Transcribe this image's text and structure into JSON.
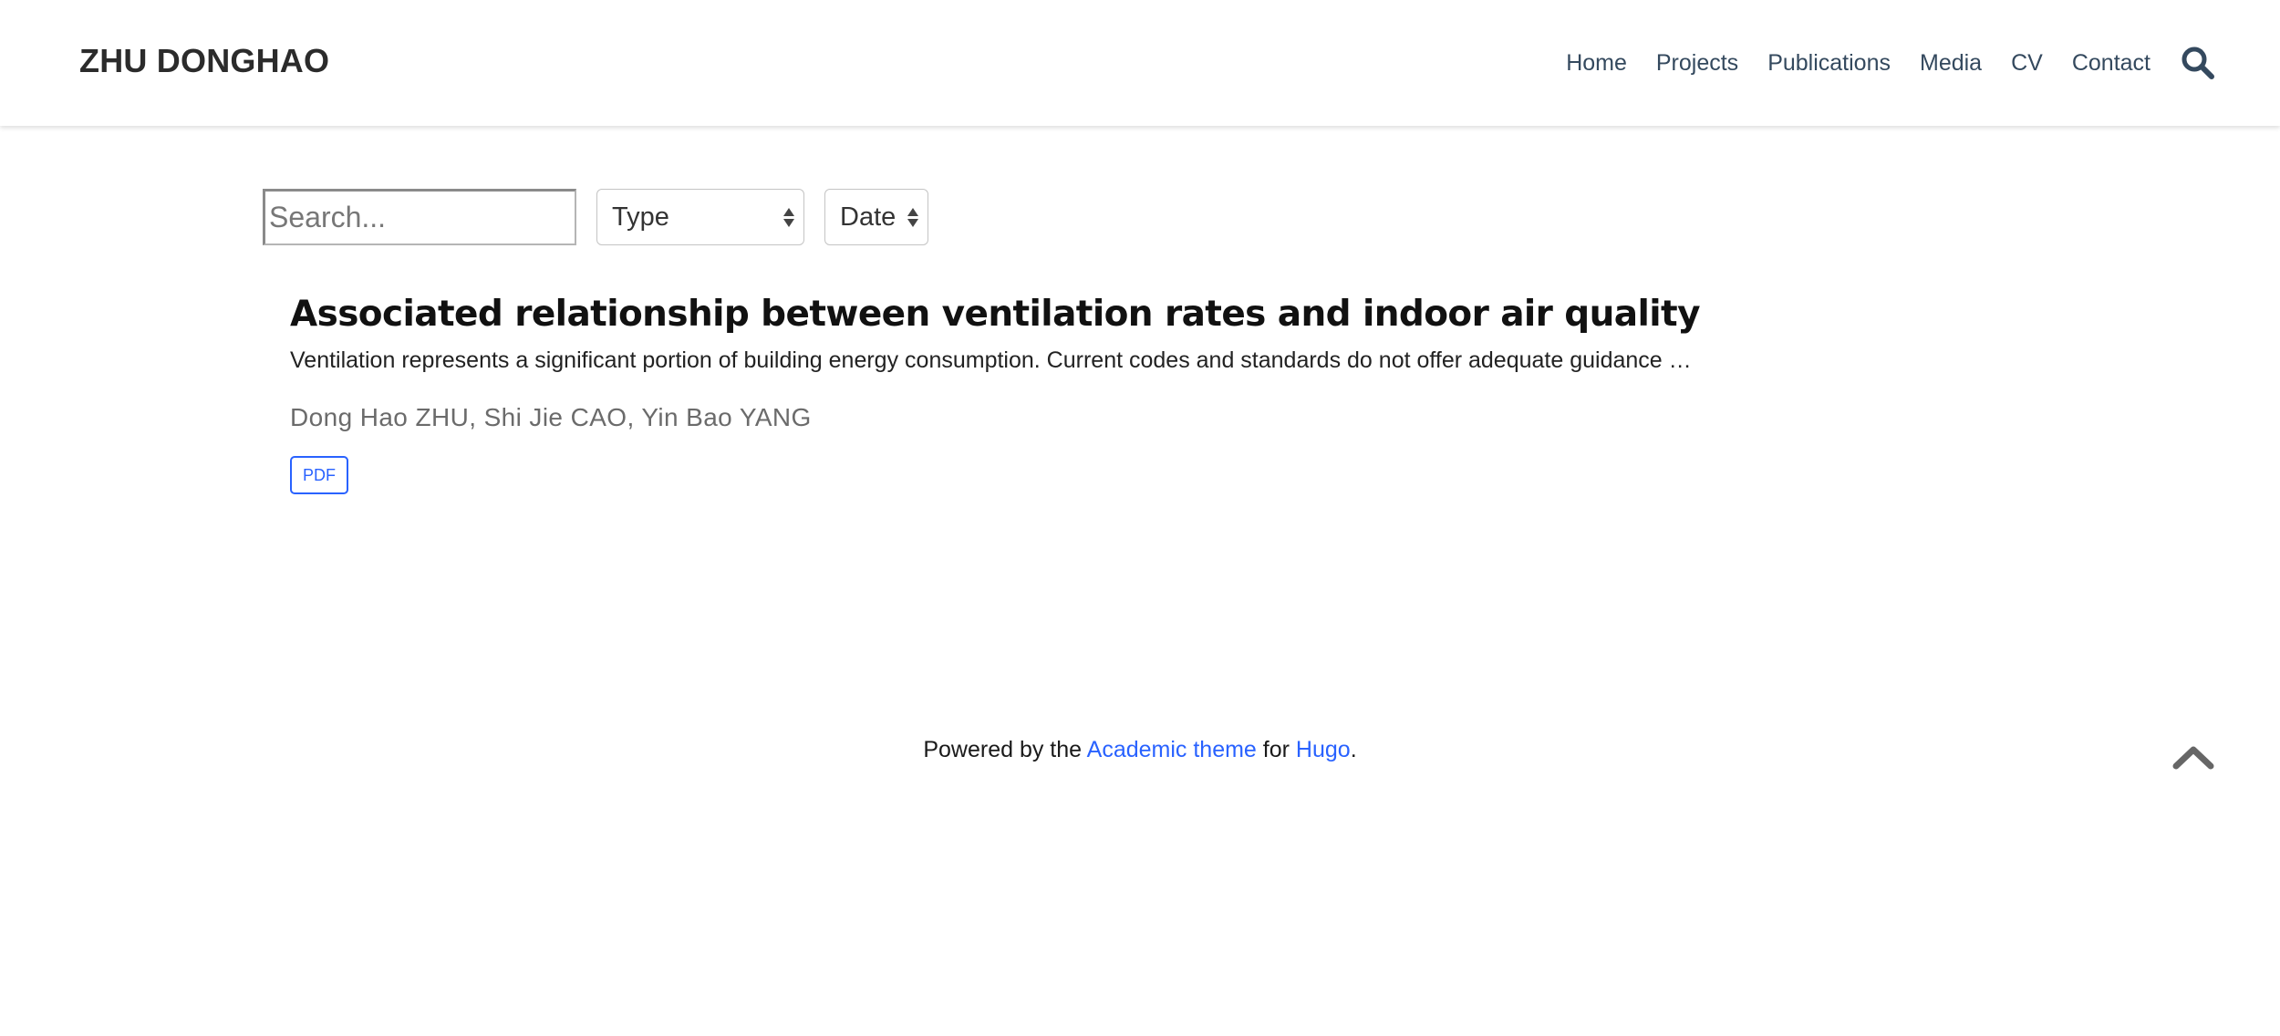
{
  "navbar": {
    "brand": "ZHU DONGHAO",
    "items": [
      {
        "label": "Home"
      },
      {
        "label": "Projects"
      },
      {
        "label": "Publications"
      },
      {
        "label": "Media"
      },
      {
        "label": "CV"
      },
      {
        "label": "Contact"
      }
    ],
    "search_icon": "search-icon"
  },
  "filters": {
    "search_placeholder": "Search...",
    "search_value": "",
    "type_selected": "Type",
    "date_selected": "Date"
  },
  "publications": [
    {
      "title": "Associated relationship between ventilation rates and indoor air quality",
      "summary": "Ventilation represents a significant portion of building energy consumption. Current codes and standards do not offer adequate guidance …",
      "authors": "Dong Hao ZHU, Shi Jie CAO, Yin Bao YANG",
      "buttons": [
        {
          "label": "PDF"
        }
      ]
    }
  ],
  "footer": {
    "prefix": "Powered by the ",
    "theme_link": "Academic theme",
    "middle": " for ",
    "hugo_link": "Hugo",
    "suffix": "."
  },
  "back_to_top_icon": "chevron-up-icon",
  "colors": {
    "link": "#2962ff",
    "nav_text": "#34495e",
    "brand": "#2b2b2b",
    "authors": "#6b6b6b"
  }
}
